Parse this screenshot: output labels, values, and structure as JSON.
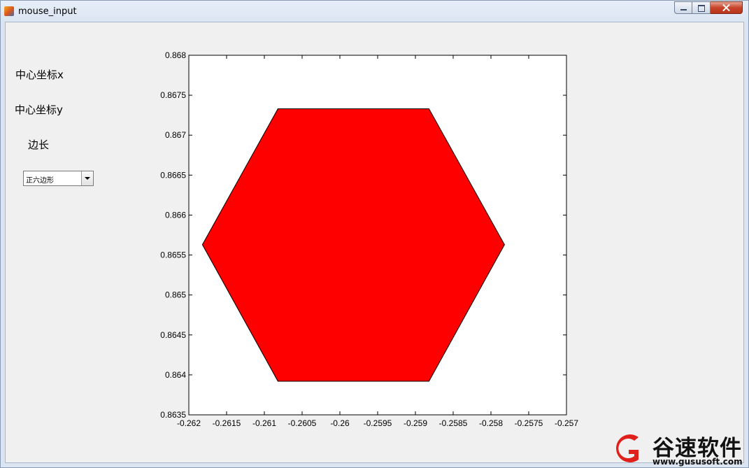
{
  "window": {
    "title": "mouse_input"
  },
  "controls": {
    "label_center_x": "中心坐标x",
    "label_center_y": "中心坐标y",
    "label_side": "边长",
    "shape_select": {
      "selected": "正六边形"
    }
  },
  "chart_data": {
    "type": "area",
    "xlim": [
      -0.262,
      -0.257
    ],
    "ylim": [
      0.8635,
      0.868
    ],
    "x_ticks": [
      -0.262,
      -0.2615,
      -0.261,
      -0.2605,
      -0.26,
      -0.2595,
      -0.259,
      -0.2585,
      -0.258,
      -0.2575,
      -0.257
    ],
    "x_tick_labels": [
      "-0.262",
      "-0.2615",
      "-0.261",
      "-0.2605",
      "-0.26",
      "-0.2595",
      "-0.259",
      "-0.2585",
      "-0.258",
      "-0.2575",
      "-0.257"
    ],
    "y_ticks": [
      0.8635,
      0.864,
      0.8645,
      0.865,
      0.8655,
      0.866,
      0.8665,
      0.867,
      0.8675,
      0.868
    ],
    "y_tick_labels": [
      "0.8635",
      "0.864",
      "0.8645",
      "0.865",
      "0.8655",
      "0.866",
      "0.8665",
      "0.867",
      "0.8675",
      "0.868"
    ],
    "polygon": {
      "fill": "#ff0000",
      "edge": "#000000",
      "vertices": [
        [
          -0.26082,
          0.86733
        ],
        [
          -0.25882,
          0.86733
        ],
        [
          -0.25782,
          0.86563
        ],
        [
          -0.25882,
          0.86392
        ],
        [
          -0.26082,
          0.86392
        ],
        [
          -0.26182,
          0.86563
        ]
      ]
    }
  },
  "watermark": {
    "name": "谷速软件",
    "url": "www.gususoft.com",
    "color": "#e0201a"
  }
}
